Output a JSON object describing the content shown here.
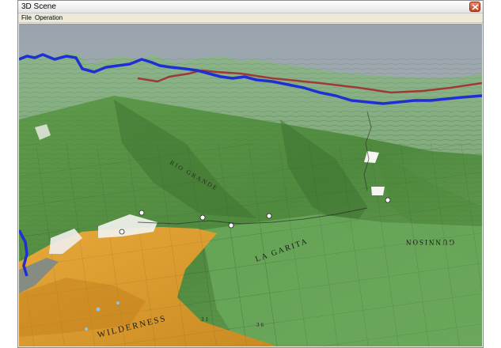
{
  "window": {
    "title": "3D Scene"
  },
  "menu": {
    "items": [
      {
        "label": "File"
      },
      {
        "label": "Operation"
      }
    ]
  },
  "scene": {
    "labels": {
      "la_garita": "LA GARITA",
      "gunnison": "GUNNISON",
      "wilderness": "WILDERNESS",
      "rio_grande": "RIO GRANDE",
      "numbers": [
        "31",
        "36"
      ]
    },
    "colors": {
      "sky": "#a6aeb6",
      "forest": "#5a9a4a",
      "forest_light": "#78ad64",
      "wilderness": "#e1a32e",
      "river": "#1f2fd4",
      "road": "#a23a3a"
    }
  }
}
